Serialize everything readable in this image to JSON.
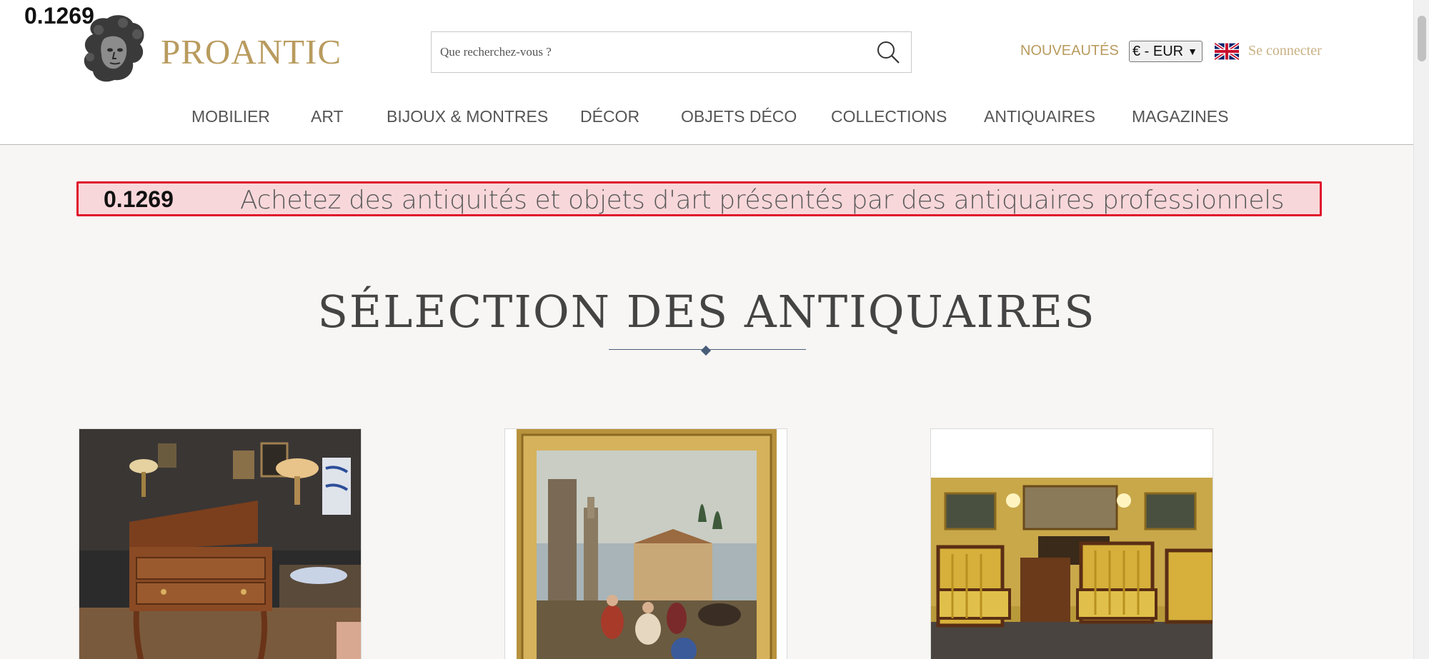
{
  "overlay_score": "0.1269",
  "header": {
    "logo_text": "PROANTIC",
    "search_placeholder": "Que recherchez-vous ?",
    "nouveautes_label": "NOUVEAUTÉS",
    "currency_value": "€ - EUR",
    "language_flag": "uk-flag-icon",
    "login_label": "Se connecter"
  },
  "nav": {
    "items": [
      {
        "label": "MOBILIER"
      },
      {
        "label": "ART"
      },
      {
        "label": "BIJOUX & MONTRES"
      },
      {
        "label": "DÉCOR"
      },
      {
        "label": "OBJETS DÉCO"
      },
      {
        "label": "COLLECTIONS"
      },
      {
        "label": "ANTIQUAIRES"
      },
      {
        "label": "MAGAZINES"
      }
    ]
  },
  "banner": {
    "score": "0.1269",
    "text": "Achetez des antiquités et objets d'art présentés par des antiquaires professionnels"
  },
  "section": {
    "title": "SÉLECTION DES ANTIQUAIRES"
  },
  "cards": [
    {
      "image": "antique-writing-desk-image"
    },
    {
      "image": "framed-painting-image"
    },
    {
      "image": "yellow-armchairs-salon-image"
    }
  ],
  "colors": {
    "brand_gold": "#b89b5e",
    "banner_bg": "#f8d7da",
    "banner_border": "#e0142b",
    "rule": "#4a5d79"
  }
}
